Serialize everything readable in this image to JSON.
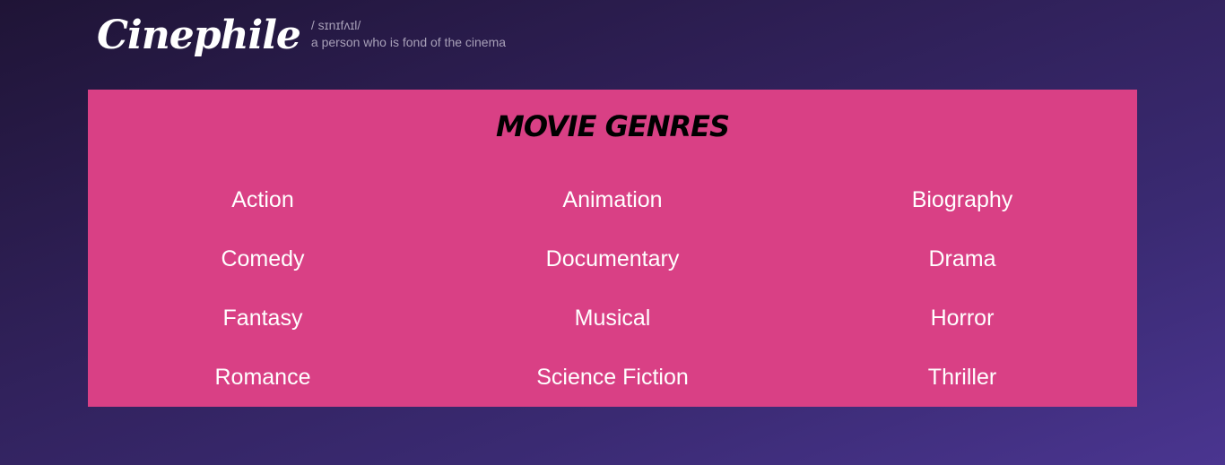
{
  "header": {
    "logo": "Cinephile",
    "phonetic": "/ sɪnɪfʌɪl/",
    "definition": "a person who is fond of the cinema"
  },
  "panel": {
    "title": "Movie Genres",
    "genres": [
      "Action",
      "Animation",
      "Biography",
      "Comedy",
      "Documentary",
      "Drama",
      "Fantasy",
      "Musical",
      "Horror",
      "Romance",
      "Science Fiction",
      "Thriller"
    ]
  },
  "colors": {
    "panel_bg": "#d94085",
    "page_bg_start": "#1f1436",
    "page_bg_end": "#4a3590"
  }
}
